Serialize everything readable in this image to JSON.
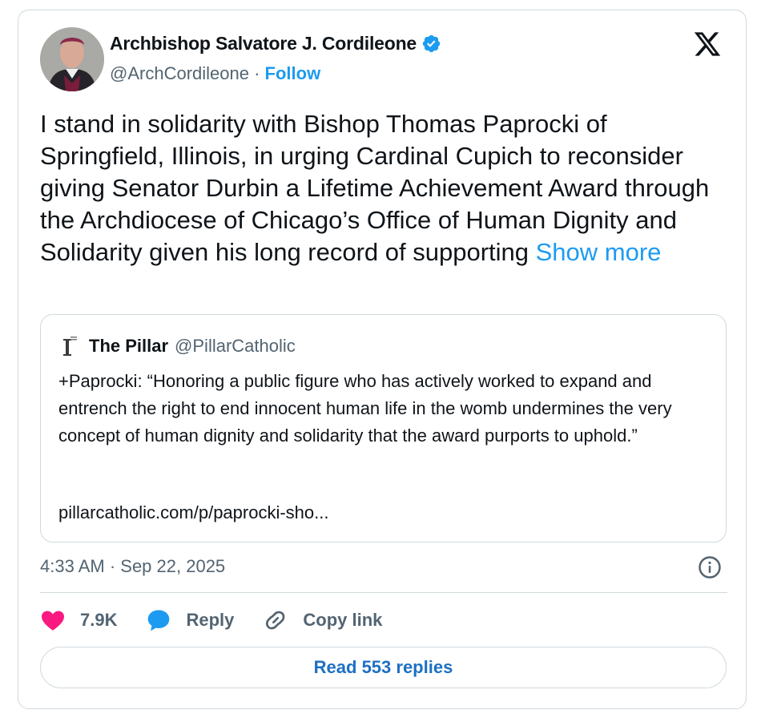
{
  "author": {
    "name": "Archbishop Salvatore J. Cordileone",
    "handle": "@ArchCordileone",
    "separator": " · ",
    "follow_label": "Follow",
    "verified_color": "#1d9bf0"
  },
  "tweet": {
    "text": "I stand in solidarity with Bishop Thomas Paprocki of Springfield, Illinois, in urging Cardinal Cupich to reconsider giving Senator Durbin a Lifetime Achievement Award through the Archdiocese of Chicago’s Office of Human Dignity and Solidarity given his long record of supporting ",
    "show_more_label": "Show more",
    "timestamp": "4:33 AM · Sep 22, 2025"
  },
  "quote": {
    "name": "The Pillar",
    "handle": "@PillarCatholic",
    "text": "+Paprocki: “Honoring a public figure who has actively worked to expand and entrench the right to end innocent human life in the womb undermines the very concept of human dignity and solidarity that the award purports to uphold.”",
    "link": "pillarcatholic.com/p/paprocki-sho..."
  },
  "actions": {
    "likes": "7.9K",
    "reply_label": "Reply",
    "copy_link_label": "Copy link",
    "read_replies_label": "Read 553 replies"
  },
  "icons": {
    "like": "heart-icon",
    "reply": "speech-bubble-icon",
    "copy_link": "link-icon",
    "info": "info-icon",
    "brand": "x-logo-icon"
  },
  "colors": {
    "accent": "#1d9bf0",
    "like": "#f91880",
    "muted": "#536471",
    "border": "#cfd9de"
  }
}
